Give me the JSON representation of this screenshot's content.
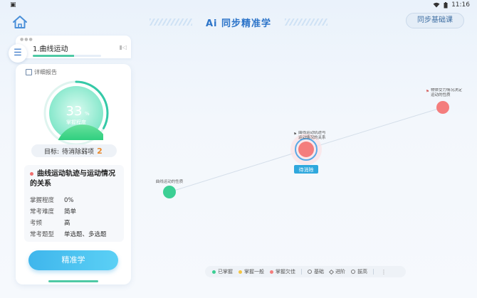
{
  "status": {
    "left": "▣",
    "time": "11:16"
  },
  "header": {
    "title": "Ai 同步精准学",
    "right_button": "同步基础课"
  },
  "chapter": {
    "name": "1.曲线运动",
    "progress": 0.6
  },
  "card": {
    "report_link": "详细报告",
    "gauge": {
      "value": "33",
      "unit": "%",
      "label": "掌握程度",
      "fraction": 0.33
    },
    "target": {
      "label": "目标:",
      "text": "待消除弱项",
      "count": "2"
    },
    "knowledge": {
      "title": "曲线运动轨迹与运动情况的关系",
      "rows": [
        {
          "k": "掌握程度",
          "v": "0%"
        },
        {
          "k": "常考难度",
          "v": "简单"
        },
        {
          "k": "考频",
          "v": "高"
        },
        {
          "k": "常考题型",
          "v": "单选题、多选题"
        }
      ]
    },
    "button": "精准学"
  },
  "graph": {
    "nodes": [
      {
        "id": "n1",
        "label": "曲线运动的性质",
        "status": "mastered",
        "color": "#3ccf94"
      },
      {
        "id": "n2",
        "label": "曲线运动轨迹与运动情况的关系",
        "status": "current",
        "color": "#f47d7d",
        "badge": "待消除"
      },
      {
        "id": "n3",
        "label": "物体受力情况决定运动的性质",
        "status": "weak",
        "color": "#f47d7d"
      }
    ]
  },
  "legend": {
    "items": [
      {
        "label": "已掌握",
        "color": "#3ccf94"
      },
      {
        "label": "掌握一般",
        "color": "#f5c542"
      },
      {
        "label": "掌握欠佳",
        "color": "#f47d7d"
      }
    ],
    "levels": [
      "基础",
      "进阶",
      "拔高"
    ]
  }
}
